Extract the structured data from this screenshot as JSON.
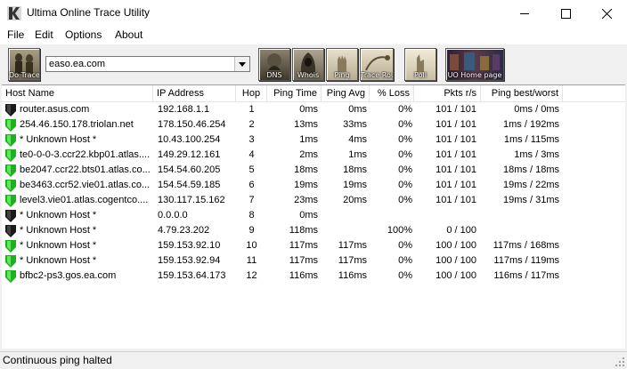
{
  "window": {
    "title": "Ultima Online Trace Utility"
  },
  "menu": [
    "File",
    "Edit",
    "Options",
    "About"
  ],
  "toolbar": {
    "host": "easo.ea.com",
    "buttons": [
      {
        "name": "trace-button",
        "label": "Do Trace"
      },
      {
        "name": "dns-button",
        "label": "DNS"
      },
      {
        "name": "whois-button",
        "label": "Whois"
      },
      {
        "name": "ping-button",
        "label": "Ping"
      },
      {
        "name": "trace-route-button",
        "label": "Trace Route"
      },
      {
        "name": "poll-button",
        "label": "Poll"
      },
      {
        "name": "uo-homepage-button",
        "label": "UO Home page"
      }
    ]
  },
  "columns": [
    "Host Name",
    "IP Address",
    "Hop",
    "Ping Time",
    "Ping Avg",
    "% Loss",
    "Pkts r/s",
    "Ping best/worst"
  ],
  "rows": [
    {
      "status": "black",
      "host": "router.asus.com",
      "ip": "192.168.1.1",
      "hop": "1",
      "ping": "0ms",
      "avg": "0ms",
      "loss": "0%",
      "pkts": "101 / 101",
      "bw": "0ms / 0ms"
    },
    {
      "status": "green",
      "host": "254.46.150.178.triolan.net",
      "ip": "178.150.46.254",
      "hop": "2",
      "ping": "13ms",
      "avg": "33ms",
      "loss": "0%",
      "pkts": "101 / 101",
      "bw": "1ms / 192ms"
    },
    {
      "status": "green",
      "host": "* Unknown Host *",
      "ip": "10.43.100.254",
      "hop": "3",
      "ping": "1ms",
      "avg": "4ms",
      "loss": "0%",
      "pkts": "101 / 101",
      "bw": "1ms / 115ms"
    },
    {
      "status": "green",
      "host": "te0-0-0-3.ccr22.kbp01.atlas....",
      "ip": "149.29.12.161",
      "hop": "4",
      "ping": "2ms",
      "avg": "1ms",
      "loss": "0%",
      "pkts": "101 / 101",
      "bw": "1ms / 3ms"
    },
    {
      "status": "green",
      "host": "be2047.ccr22.bts01.atlas.co...",
      "ip": "154.54.60.205",
      "hop": "5",
      "ping": "18ms",
      "avg": "18ms",
      "loss": "0%",
      "pkts": "101 / 101",
      "bw": "18ms / 18ms"
    },
    {
      "status": "green",
      "host": "be3463.ccr52.vie01.atlas.co...",
      "ip": "154.54.59.185",
      "hop": "6",
      "ping": "19ms",
      "avg": "19ms",
      "loss": "0%",
      "pkts": "101 / 101",
      "bw": "19ms / 22ms"
    },
    {
      "status": "green",
      "host": "level3.vie01.atlas.cogentco....",
      "ip": "130.117.15.162",
      "hop": "7",
      "ping": "23ms",
      "avg": "20ms",
      "loss": "0%",
      "pkts": "101 / 101",
      "bw": "19ms / 31ms"
    },
    {
      "status": "black",
      "host": "* Unknown Host *",
      "ip": "0.0.0.0",
      "hop": "8",
      "ping": "0ms",
      "avg": "",
      "loss": "",
      "pkts": "",
      "bw": ""
    },
    {
      "status": "black",
      "host": "* Unknown Host *",
      "ip": "4.79.23.202",
      "hop": "9",
      "ping": "118ms",
      "avg": "",
      "loss": "100%",
      "pkts": "0 / 100",
      "bw": ""
    },
    {
      "status": "green",
      "host": "* Unknown Host *",
      "ip": "159.153.92.10",
      "hop": "10",
      "ping": "117ms",
      "avg": "117ms",
      "loss": "0%",
      "pkts": "100 / 100",
      "bw": "117ms / 168ms"
    },
    {
      "status": "green",
      "host": "* Unknown Host *",
      "ip": "159.153.92.94",
      "hop": "11",
      "ping": "117ms",
      "avg": "117ms",
      "loss": "0%",
      "pkts": "100 / 100",
      "bw": "117ms / 119ms"
    },
    {
      "status": "green",
      "host": "bfbc2-ps3.gos.ea.com",
      "ip": "159.153.64.173",
      "hop": "12",
      "ping": "116ms",
      "avg": "116ms",
      "loss": "0%",
      "pkts": "100 / 100",
      "bw": "116ms / 117ms"
    }
  ],
  "status": {
    "text": "Continuous ping halted"
  },
  "colors": {
    "ok": "#1fb01f",
    "down": "#1a1a1a"
  }
}
